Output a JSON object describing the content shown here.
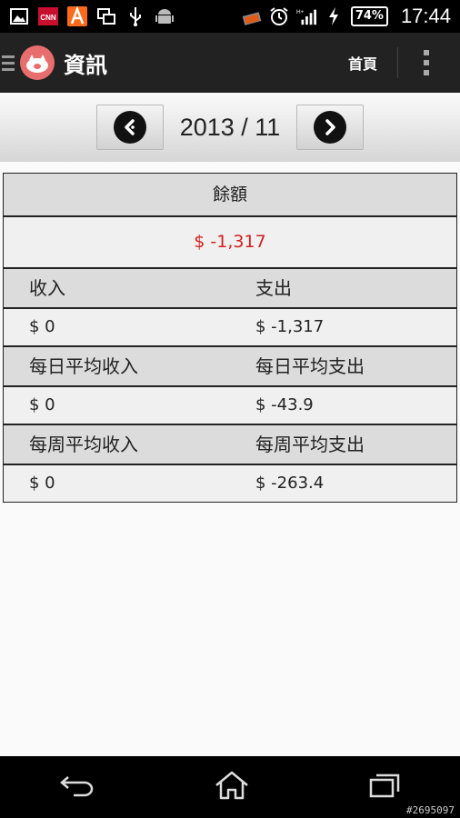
{
  "status_bar": {
    "icons": [
      "gallery-icon",
      "cnn-icon",
      "a-app-icon",
      "screens-icon",
      "usb-icon",
      "android-icon"
    ],
    "right_icons": [
      "wallet-icon",
      "alarm-icon",
      "signal-icon",
      "charging-icon"
    ],
    "battery": "74%",
    "time": "17:44"
  },
  "action_bar": {
    "title": "資訊",
    "home_label": "首頁"
  },
  "month_nav": {
    "label": "2013 / 11"
  },
  "summary": {
    "balance_label": "餘額",
    "balance_value": "$ -1,317",
    "income_label": "收入",
    "expense_label": "支出",
    "income_value": "$ 0",
    "expense_value": "$ -1,317",
    "daily_income_label": "每日平均收入",
    "daily_expense_label": "每日平均支出",
    "daily_income_value": "$ 0",
    "daily_expense_value": "$ -43.9",
    "weekly_income_label": "每周平均收入",
    "weekly_expense_label": "每周平均支出",
    "weekly_income_value": "$ 0",
    "weekly_expense_value": "$ -263.4"
  },
  "colors": {
    "balance_negative": "#d42020",
    "action_bar": "#222222"
  },
  "watermark": "#2695097"
}
